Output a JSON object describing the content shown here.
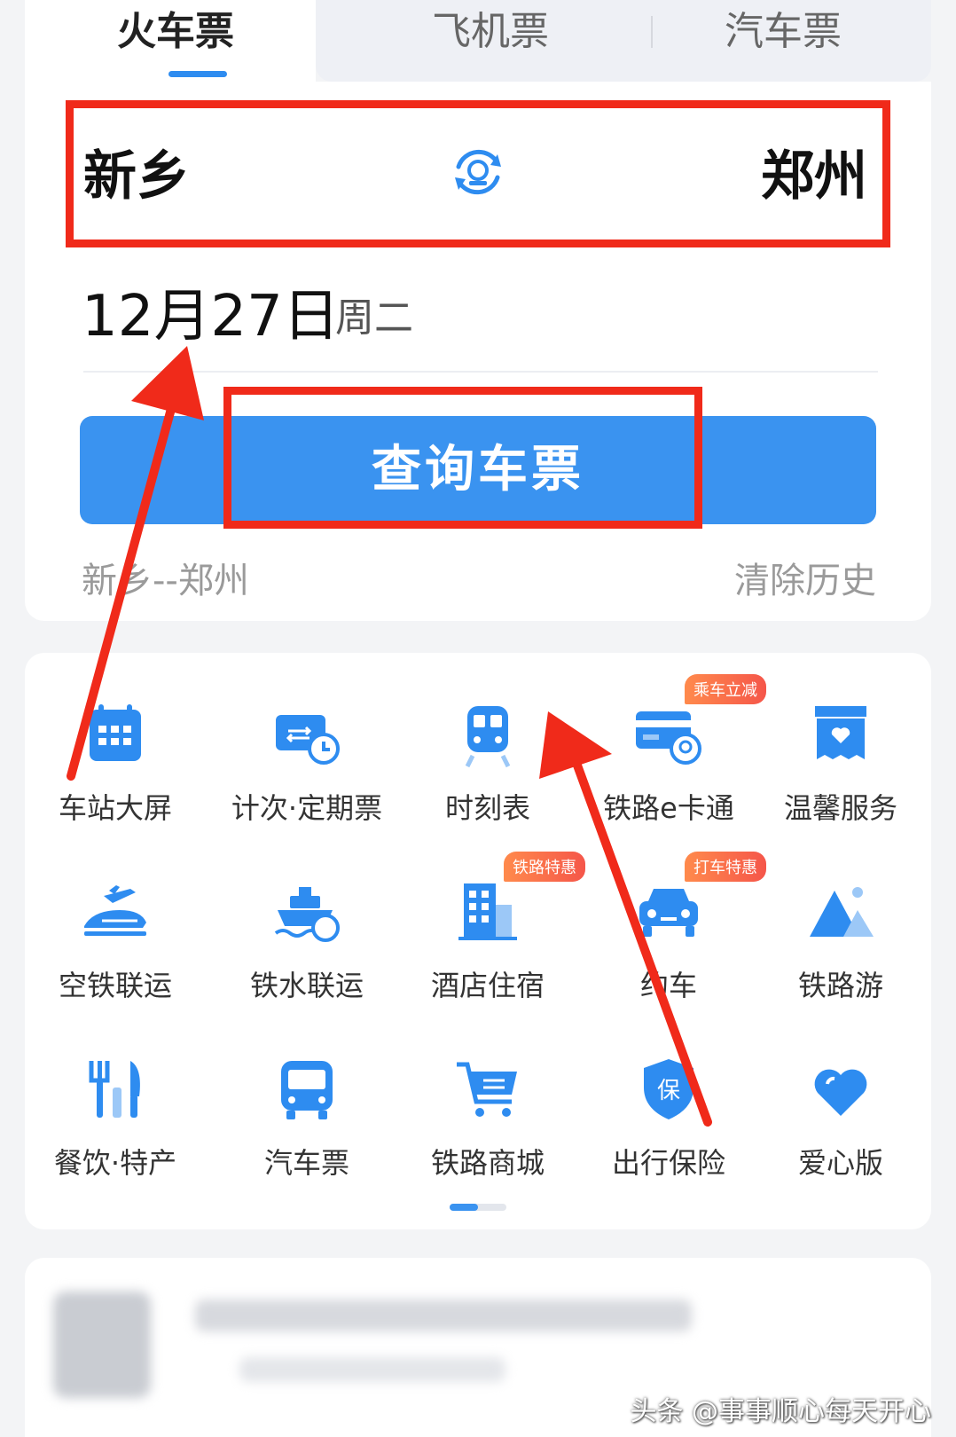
{
  "tabs": {
    "train": "火车票",
    "plane": "飞机票",
    "bus": "汽车票"
  },
  "route": {
    "from": "新乡",
    "to": "郑州"
  },
  "date": {
    "value": "12月27日",
    "weekday": "周二"
  },
  "search_button": "查询车票",
  "history": {
    "entry": "新乡--郑州",
    "clear": "清除历史"
  },
  "grid": [
    {
      "label": "车站大屏",
      "icon": "calendar-screen-icon"
    },
    {
      "label": "计次·定期票",
      "icon": "ticket-clock-icon"
    },
    {
      "label": "时刻表",
      "icon": "train-timetable-icon"
    },
    {
      "label": "铁路e卡通",
      "icon": "card-icon",
      "badge": "乘车立减"
    },
    {
      "label": "温馨服务",
      "icon": "heart-box-icon"
    },
    {
      "label": "空铁联运",
      "icon": "plane-train-icon"
    },
    {
      "label": "铁水联运",
      "icon": "ship-icon"
    },
    {
      "label": "酒店住宿",
      "icon": "hotel-icon",
      "badge": "铁路特惠"
    },
    {
      "label": "约车",
      "icon": "car-icon",
      "badge": "打车特惠"
    },
    {
      "label": "铁路游",
      "icon": "mountain-icon"
    },
    {
      "label": "餐饮·特产",
      "icon": "fork-knife-icon"
    },
    {
      "label": "汽车票",
      "icon": "bus-icon"
    },
    {
      "label": "铁路商城",
      "icon": "cart-icon"
    },
    {
      "label": "出行保险",
      "icon": "shield-insurance-icon"
    },
    {
      "label": "爱心版",
      "icon": "heart-icon"
    }
  ],
  "watermark": "头条 @事事顺心每天开心",
  "colors": {
    "accent": "#3a93f0",
    "highlight_red": "#f02a1a"
  }
}
